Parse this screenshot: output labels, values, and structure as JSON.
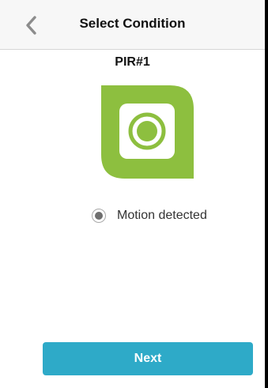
{
  "navbar": {
    "title": "Select Condition",
    "back_icon": "chevron-left-icon"
  },
  "device": {
    "name": "PIR#1",
    "icon": "pir-sensor-icon",
    "icon_color": "#8dbf3f"
  },
  "condition": {
    "option_label": "Motion detected",
    "selected": true
  },
  "footer": {
    "next_label": "Next",
    "button_color": "#2eaac8"
  }
}
